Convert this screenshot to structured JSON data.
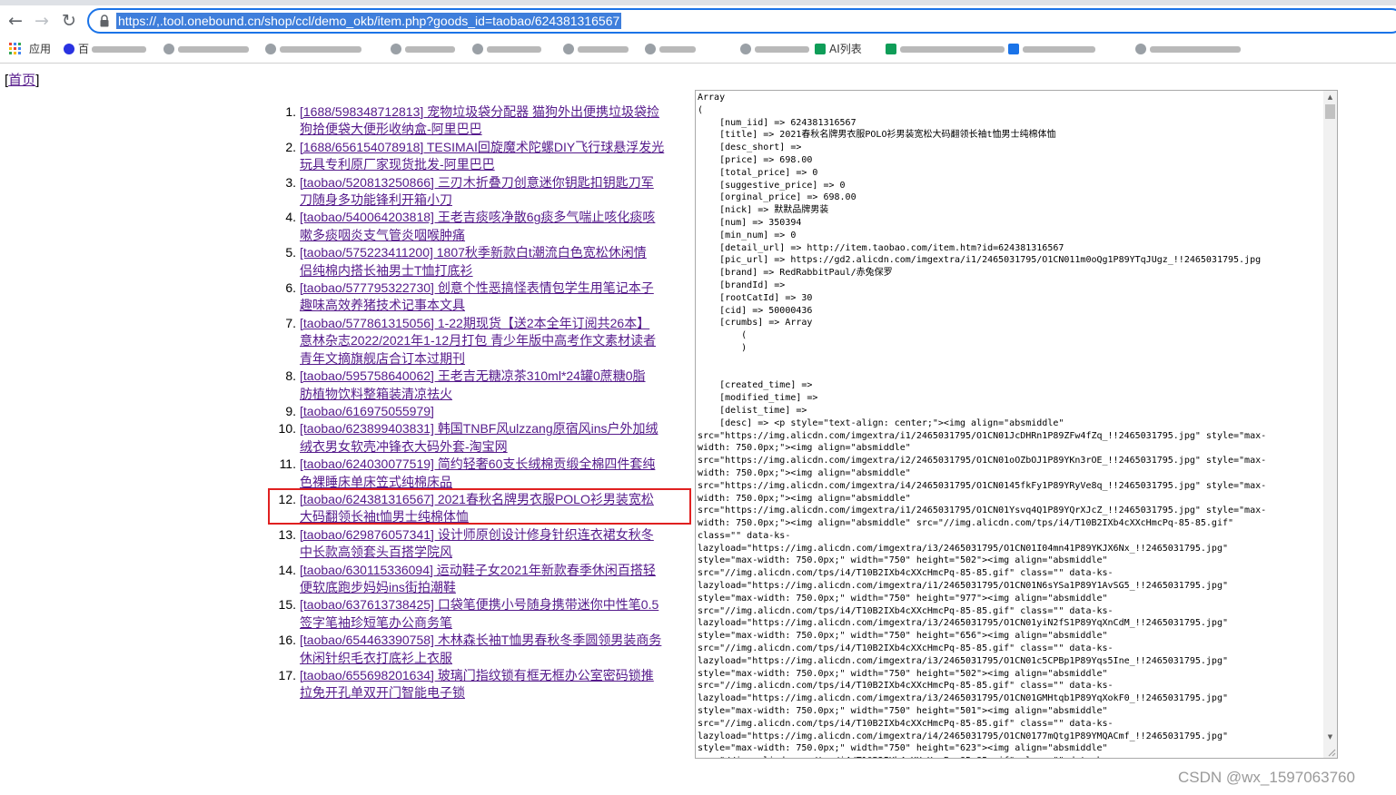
{
  "browser": {
    "url": "https://,.tool.onebound.cn/shop/ccl/demo_okb/item.php?goods_id=taobao/624381316567",
    "bookmarks": {
      "apps_label": "应用",
      "items": [
        {
          "label": "百",
          "icon_color": "#2932e1"
        },
        {
          "label": "",
          "icon_color": "#9aa0a6"
        },
        {
          "label": "",
          "icon_color": "#9aa0a6"
        },
        {
          "label": "",
          "icon_color": "#9aa0a6"
        },
        {
          "label": "",
          "icon_color": "#9aa0a6"
        },
        {
          "label": "",
          "icon_color": "#9aa0a6"
        },
        {
          "label": "",
          "icon_color": "#9aa0a6"
        },
        {
          "label": "",
          "icon_color": "#9aa0a6"
        },
        {
          "label": "AI列表",
          "icon_color": "#0f9d58"
        },
        {
          "label": "",
          "icon_color": "#0f9d58"
        },
        {
          "label": "",
          "icon_color": "#1a73e8"
        },
        {
          "label": "",
          "icon_color": "#9aa0a6"
        }
      ]
    }
  },
  "page": {
    "home_link": "首页",
    "goods": [
      {
        "num": "1.",
        "line1": "[1688/598348712813] 宠物垃圾袋分配器 猫狗外出便携垃圾袋捡",
        "line2": "狗拾便袋大便形收纳盒-阿里巴巴"
      },
      {
        "num": "2.",
        "line1": "[1688/656154078918] TESIMAI回旋魔术陀螺DIY飞行球悬浮发光",
        "line2": "玩具专利原厂家现货批发-阿里巴巴"
      },
      {
        "num": "3.",
        "line1": "[taobao/520813250866] 三刃木折叠刀创意迷你钥匙扣钥匙刀军",
        "line2": "刀随身多功能锋利开箱小刀"
      },
      {
        "num": "4.",
        "line1": "[taobao/540064203818] 王老吉痰咳净散6g痰多气喘止咳化痰咳",
        "line2": "嗽多痰咽炎支气管炎咽喉肿痛"
      },
      {
        "num": "5.",
        "line1": "[taobao/575223411200] 1807秋季新款白t潮流白色宽松休闲情",
        "line2": "侣纯棉内搭长袖男士T恤打底衫"
      },
      {
        "num": "6.",
        "line1": "[taobao/577795322730] 创意个性恶搞怪表情包学生用笔记本子",
        "line2": "趣味高效养猪技术记事本文具"
      },
      {
        "num": "7.",
        "line1": "[taobao/577861315056] 1-22期现货【送2本全年订阅共26本】",
        "line2": "意林杂志2022/2021年1-12月打包 青少年版中高考作文素材读者",
        "line3": "青年文摘旗舰店合订本过期刊"
      },
      {
        "num": "8.",
        "line1": "[taobao/595758640062] 王老吉无糖凉茶310ml*24罐0蔗糖0脂",
        "line2": "肪植物饮料整箱装清凉祛火"
      },
      {
        "num": "9.",
        "line1": "[taobao/616975055979]"
      },
      {
        "num": "10.",
        "line1": "[taobao/623899403831] 韩国TNBF风ulzzang原宿风ins户外加绒",
        "line2": "绒衣男女软壳冲锋衣大码外套-淘宝网"
      },
      {
        "num": "11.",
        "line1": "[taobao/624030077519] 简约轻奢60支长绒棉贡缎全棉四件套纯",
        "line2": "色裸睡床单床笠式纯棉床品"
      },
      {
        "num": "12.",
        "line1": "[taobao/624381316567] 2021春秋名牌男衣服POLO衫男装宽松",
        "line2": "大码翻领长袖t恤男士纯棉体恤"
      },
      {
        "num": "13.",
        "line1": "[taobao/629876057341] 设计师原创设计修身针织连衣裙女秋冬",
        "line2": "中长款高领套头百搭学院风"
      },
      {
        "num": "14.",
        "line1": "[taobao/630115336094] 运动鞋子女2021年新款春季休闲百搭轻",
        "line2": "便软底跑步妈妈ins街拍潮鞋"
      },
      {
        "num": "15.",
        "line1": "[taobao/637613738425] 口袋笔便携小号随身携带迷你中性笔0.5",
        "line2": "签字笔袖珍短笔办公商务笔"
      },
      {
        "num": "16.",
        "line1": "[taobao/654463390758] 木林森长袖T恤男春秋冬季圆领男装商务",
        "line2": "休闲针织毛衣打底衫上衣服"
      },
      {
        "num": "17.",
        "line1": "[taobao/655698201634] 玻璃门指纹锁有框无框办公室密码锁推",
        "line2": "拉免开孔单双开门智能电子锁"
      }
    ],
    "dump_text": "Array\n(\n    [num_iid] => 624381316567\n    [title] => 2021春秋名牌男衣服POLO衫男装宽松大码翻领长袖t恤男士纯棉体恤\n    [desc_short] =>\n    [price] => 698.00\n    [total_price] => 0\n    [suggestive_price] => 0\n    [orginal_price] => 698.00\n    [nick] => 默默品牌男装\n    [num] => 350394\n    [min_num] => 0\n    [detail_url] => http://item.taobao.com/item.htm?id=624381316567\n    [pic_url] => https://gd2.alicdn.com/imgextra/i1/2465031795/O1CN011m0oQg1P89YTqJUgz_!!2465031795.jpg\n    [brand] => RedRabbitPaul/赤兔保罗\n    [brandId] =>\n    [rootCatId] => 30\n    [cid] => 50000436\n    [crumbs] => Array\n        (\n        )\n\n\n    [created_time] =>\n    [modified_time] =>\n    [delist_time] =>\n    [desc] => <p style=\"text-align: center;\"><img align=\"absmiddle\"\nsrc=\"https://img.alicdn.com/imgextra/i1/2465031795/O1CN01JcDHRn1P89ZFw4fZq_!!2465031795.jpg\" style=\"max-\nwidth: 750.0px;\"><img align=\"absmiddle\"\nsrc=\"https://img.alicdn.com/imgextra/i2/2465031795/O1CN01oOZbOJ1P89YKn3rOE_!!2465031795.jpg\" style=\"max-\nwidth: 750.0px;\"><img align=\"absmiddle\"\nsrc=\"https://img.alicdn.com/imgextra/i4/2465031795/O1CN0145fkFy1P89YRyVe8q_!!2465031795.jpg\" style=\"max-\nwidth: 750.0px;\"><img align=\"absmiddle\"\nsrc=\"https://img.alicdn.com/imgextra/i1/2465031795/O1CN01Ysvq4Q1P89YQrXJcZ_!!2465031795.jpg\" style=\"max-\nwidth: 750.0px;\"><img align=\"absmiddle\" src=\"//img.alicdn.com/tps/i4/T10B2IXb4cXXcHmcPq-85-85.gif\"\nclass=\"\" data-ks-\nlazyload=\"https://img.alicdn.com/imgextra/i3/2465031795/O1CN01I04mn41P89YKJX6Nx_!!2465031795.jpg\"\nstyle=\"max-width: 750.0px;\" width=\"750\" height=\"502\"><img align=\"absmiddle\"\nsrc=\"//img.alicdn.com/tps/i4/T10B2IXb4cXXcHmcPq-85-85.gif\" class=\"\" data-ks-\nlazyload=\"https://img.alicdn.com/imgextra/i1/2465031795/O1CN01N6sYSa1P89Y1AvSG5_!!2465031795.jpg\"\nstyle=\"max-width: 750.0px;\" width=\"750\" height=\"977\"><img align=\"absmiddle\"\nsrc=\"//img.alicdn.com/tps/i4/T10B2IXb4cXXcHmcPq-85-85.gif\" class=\"\" data-ks-\nlazyload=\"https://img.alicdn.com/imgextra/i3/2465031795/O1CN01yiN2fS1P89YqXnCdM_!!2465031795.jpg\"\nstyle=\"max-width: 750.0px;\" width=\"750\" height=\"656\"><img align=\"absmiddle\"\nsrc=\"//img.alicdn.com/tps/i4/T10B2IXb4cXXcHmcPq-85-85.gif\" class=\"\" data-ks-\nlazyload=\"https://img.alicdn.com/imgextra/i3/2465031795/O1CN01c5CPBp1P89Yqs5Ine_!!2465031795.jpg\"\nstyle=\"max-width: 750.0px;\" width=\"750\" height=\"502\"><img align=\"absmiddle\"\nsrc=\"//img.alicdn.com/tps/i4/T10B2IXb4cXXcHmcPq-85-85.gif\" class=\"\" data-ks-\nlazyload=\"https://img.alicdn.com/imgextra/i3/2465031795/O1CN01GMHtqb1P89YqXokF0_!!2465031795.jpg\"\nstyle=\"max-width: 750.0px;\" width=\"750\" height=\"501\"><img align=\"absmiddle\"\nsrc=\"//img.alicdn.com/tps/i4/T10B2IXb4cXXcHmcPq-85-85.gif\" class=\"\" data-ks-\nlazyload=\"https://img.alicdn.com/imgextra/i4/2465031795/O1CN0177mQtg1P89YMQACmf_!!2465031795.jpg\"\nstyle=\"max-width: 750.0px;\" width=\"750\" height=\"623\"><img align=\"absmiddle\"\nsrc=\"//img.alicdn.com/tps/i4/T10B2IXb4cXXcHmcPq-85-85.gif\" class=\"\" data-ks-"
  },
  "watermark": "CSDN @wx_1597063760",
  "colors": {
    "link_visited": "#551a8b",
    "highlight_border": "#e02020",
    "omnibox_focus": "#1a73e8",
    "url_selection": "#3e7edb"
  }
}
